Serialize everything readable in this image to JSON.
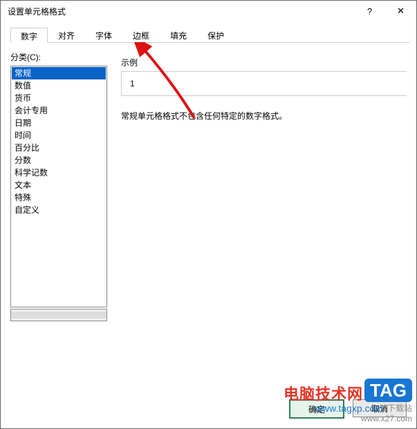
{
  "window": {
    "title": "设置单元格格式",
    "help_glyph": "?",
    "close_glyph": "✕"
  },
  "tabs": [
    {
      "label": "数字",
      "active": true
    },
    {
      "label": "对齐",
      "active": false
    },
    {
      "label": "字体",
      "active": false
    },
    {
      "label": "边框",
      "active": false
    },
    {
      "label": "填充",
      "active": false
    },
    {
      "label": "保护",
      "active": false
    }
  ],
  "category": {
    "label": "分类(C):",
    "items": [
      "常规",
      "数值",
      "货币",
      "会计专用",
      "日期",
      "时间",
      "百分比",
      "分数",
      "科学记数",
      "文本",
      "特殊",
      "自定义"
    ],
    "selected_index": 0
  },
  "sample": {
    "label": "示例",
    "value": "1"
  },
  "description": "常规单元格格式不包含任何特定的数字格式。",
  "buttons": {
    "ok": "确定",
    "cancel": "取消"
  },
  "watermark": {
    "brand_cn": "电脑技术网",
    "tag": "TAG",
    "url": "www.tagxp.com",
    "site": "下载站",
    "siteurl": "www.x27.com"
  }
}
